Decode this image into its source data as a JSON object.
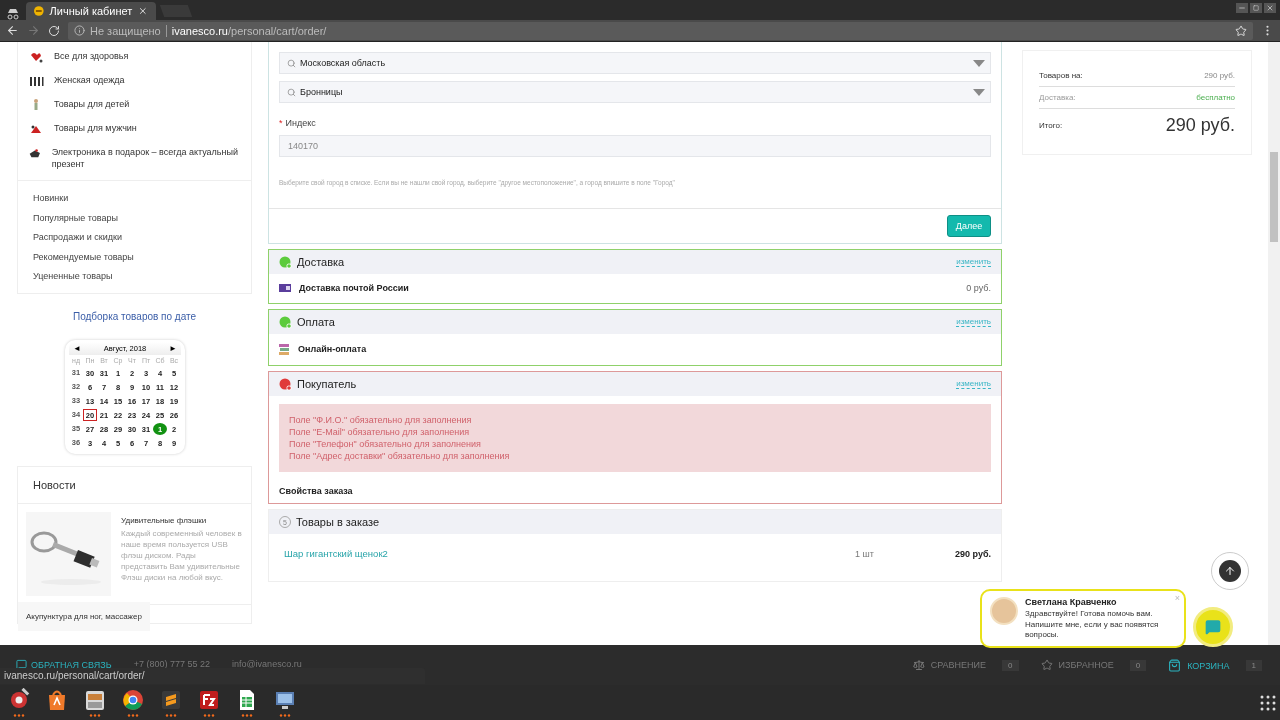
{
  "browser": {
    "tab_title": "Личный кабинет",
    "security": "Не защищено",
    "url_host": "ivanesco.ru",
    "url_path": "/personal/cart/order/"
  },
  "sidebar": {
    "categories": [
      "Все для здоровья",
      "Женская одежда",
      "Товары для детей",
      "Товары для мужчин",
      "Электроника в подарок – всегда актуальный презент"
    ],
    "links": [
      "Новинки",
      "Популярные товары",
      "Распродажи и скидки",
      "Рекомендуемые товары",
      "Уцененные товары"
    ],
    "date_link": "Подборка товаров по дате",
    "calendar": {
      "prev": "◄",
      "month": "Август, 2018",
      "next": "►",
      "weekdays": [
        "нд",
        "Пн",
        "Вт",
        "Ср",
        "Чт",
        "Пт",
        "Сб",
        "Вс"
      ],
      "weeks": [
        {
          "number": "31",
          "days": [
            {
              "d": "30",
              "today": false,
              "event": false
            },
            {
              "d": "31",
              "today": false,
              "event": false
            },
            {
              "d": "1",
              "today": false,
              "event": false
            },
            {
              "d": "2",
              "today": false,
              "event": false
            },
            {
              "d": "3",
              "today": false,
              "event": false
            },
            {
              "d": "4",
              "today": false,
              "event": false
            },
            {
              "d": "5",
              "today": false,
              "event": false
            }
          ]
        },
        {
          "number": "32",
          "days": [
            {
              "d": "6",
              "today": false,
              "event": false
            },
            {
              "d": "7",
              "today": false,
              "event": false
            },
            {
              "d": "8",
              "today": false,
              "event": false
            },
            {
              "d": "9",
              "today": false,
              "event": false
            },
            {
              "d": "10",
              "today": false,
              "event": false
            },
            {
              "d": "11",
              "today": false,
              "event": false
            },
            {
              "d": "12",
              "today": false,
              "event": false
            }
          ]
        },
        {
          "number": "33",
          "days": [
            {
              "d": "13",
              "today": false,
              "event": false
            },
            {
              "d": "14",
              "today": false,
              "event": false
            },
            {
              "d": "15",
              "today": false,
              "event": false
            },
            {
              "d": "16",
              "today": false,
              "event": false
            },
            {
              "d": "17",
              "today": false,
              "event": false
            },
            {
              "d": "18",
              "today": false,
              "event": false
            },
            {
              "d": "19",
              "today": false,
              "event": false
            }
          ]
        },
        {
          "number": "34",
          "days": [
            {
              "d": "20",
              "today": true,
              "event": false
            },
            {
              "d": "21",
              "today": false,
              "event": false
            },
            {
              "d": "22",
              "today": false,
              "event": false
            },
            {
              "d": "23",
              "today": false,
              "event": false
            },
            {
              "d": "24",
              "today": false,
              "event": false
            },
            {
              "d": "25",
              "today": false,
              "event": false
            },
            {
              "d": "26",
              "today": false,
              "event": false
            }
          ]
        },
        {
          "number": "35",
          "days": [
            {
              "d": "27",
              "today": false,
              "event": false
            },
            {
              "d": "28",
              "today": false,
              "event": false
            },
            {
              "d": "29",
              "today": false,
              "event": false
            },
            {
              "d": "30",
              "today": false,
              "event": false
            },
            {
              "d": "31",
              "today": false,
              "event": false
            },
            {
              "d": "1",
              "today": false,
              "event": true
            },
            {
              "d": "2",
              "today": false,
              "event": false
            }
          ]
        },
        {
          "number": "36",
          "days": [
            {
              "d": "3",
              "today": false,
              "event": false
            },
            {
              "d": "4",
              "today": false,
              "event": false
            },
            {
              "d": "5",
              "today": false,
              "event": false
            },
            {
              "d": "6",
              "today": false,
              "event": false
            },
            {
              "d": "7",
              "today": false,
              "event": false
            },
            {
              "d": "8",
              "today": false,
              "event": false
            },
            {
              "d": "9",
              "today": false,
              "event": false
            }
          ]
        }
      ]
    },
    "news": {
      "title": "Новости",
      "items": [
        {
          "kind": "picture",
          "title": "Удивительные флэшки",
          "text": "Каждый современный человек в наше время пользуется USB флэш диском. Рады представить Вам удивительные Флэш диски на любой вкус."
        }
      ],
      "next_title": "Акупунктура для ног, массажер"
    }
  },
  "location": {
    "region": "Московская область",
    "city": "Бронницы",
    "required_mark": "*",
    "index_label": "Индекс",
    "index_value": "140170",
    "hint": "Выберите свой город в списке. Если вы не нашли свой город, выберите \"другое местоположение\", а город впишите в поле \"Город\"",
    "next_button": "Далее"
  },
  "sections": [
    {
      "title": "Доставка",
      "kind": "done",
      "change": "изменить",
      "rows": [
        {
          "kind": "post",
          "name": "Доставка почтой России",
          "price": "0 руб."
        }
      ]
    },
    {
      "title": "Оплата",
      "kind": "done",
      "change": "изменить",
      "rows": [
        {
          "kind": "payment",
          "name": "Онлайн-оплата"
        }
      ]
    },
    {
      "title": "Покупатель",
      "kind": "error",
      "change": "изменить",
      "errors": [
        "Поле \"Ф.И.О.\" обязательно для заполнения",
        "Поле \"E-Mail\" обязательно для заполнения",
        "Поле \"Телефон\" обязательно для заполнения",
        "Поле \"Адрес доставки\" обязательно для заполнения"
      ],
      "subtitle": "Свойства заказа"
    },
    {
      "title": "Товары в заказе",
      "kind": "pending",
      "step": "5",
      "products": [
        {
          "name": "Шар гигантский щенок2",
          "qty": "1 шт",
          "price": "290 руб."
        }
      ]
    }
  ],
  "summary": {
    "goods_label": "Товаров на:",
    "goods_value": "290 руб.",
    "delivery_label": "Доставка:",
    "delivery_value": "бесплатно",
    "total_label": "Итого:",
    "total_value": "290 руб."
  },
  "footer": {
    "feedback": "ОБРАТНАЯ СВЯЗЬ",
    "phone": "+7 (800) 777 55 22",
    "email": "info@ivanesco.ru",
    "compare": "СРАВНЕНИЕ",
    "compare_count": "0",
    "favorites": "ИЗБРАННОЕ",
    "favorites_count": "0",
    "cart": "КОРЗИНА",
    "cart_count": "1"
  },
  "status_url": "ivanesco.ru/personal/cart/order/",
  "chat": {
    "name": "Светлана Кравченко",
    "message": "Здравствуйте! Готова помочь вам. Напишите мне, если у вас появятся вопросы.",
    "close": "×"
  },
  "taskbar": [
    {
      "kind": "settings",
      "running": true
    },
    {
      "kind": "store",
      "running": false
    },
    {
      "kind": "files",
      "running": true
    },
    {
      "kind": "browser",
      "running": true
    },
    {
      "kind": "editor",
      "running": true
    },
    {
      "kind": "ftp",
      "running": true
    },
    {
      "kind": "sheet",
      "running": true
    },
    {
      "kind": "monitor",
      "running": true
    }
  ]
}
